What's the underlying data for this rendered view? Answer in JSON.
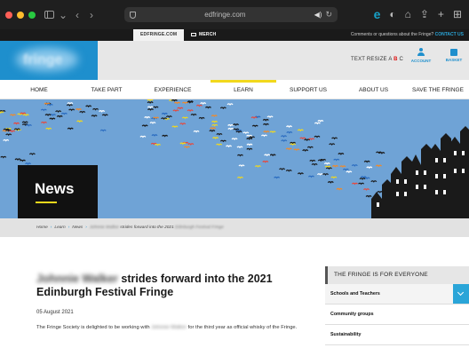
{
  "browser": {
    "url": "edfringe.com",
    "traffic_light_colors": [
      "#ff5f57",
      "#febc2e",
      "#28c840"
    ],
    "icons": [
      "sidebar-icon",
      "chevron-down-icon",
      "back-icon",
      "forward-icon",
      "shield-icon",
      "speaker-icon",
      "reload-icon",
      "extension-icon",
      "privacy-icon",
      "home-icon",
      "share-icon",
      "new-tab-icon",
      "tab-overview-icon"
    ]
  },
  "topbar": {
    "edfringe_label": "EDFRINGE.COM",
    "merch_label": "MERCH",
    "contact_prefix": "Comments or questions about the Fringe?",
    "contact_link": "CONTACT US"
  },
  "header": {
    "logo_alt": "fringe",
    "text_resize_label": "TEXT RESIZE",
    "text_resize_options": [
      "A",
      "B",
      "C"
    ],
    "account_label": "ACCOUNT",
    "basket_label": "BASKET"
  },
  "nav": {
    "items": [
      {
        "label": "HOME"
      },
      {
        "label": "TAKE PART"
      },
      {
        "label": "EXPERIENCE"
      },
      {
        "label": "LEARN",
        "active": true
      },
      {
        "label": "SUPPORT US"
      },
      {
        "label": "ABOUT US"
      },
      {
        "label": "SAVE THE FRINGE"
      }
    ],
    "active_color": "#f2d81c"
  },
  "hero": {
    "title": "News",
    "background_color": "#6fa3d6"
  },
  "breadcrumb": {
    "items": [
      "Home",
      "Learn",
      "News"
    ],
    "current_blurred": "Johnnie Walker",
    "current_rest": "strides forward into the 2021",
    "current_blurred_tail": "Edinburgh Festival Fringe"
  },
  "article": {
    "headline_blurred": "Johnnie Walker",
    "headline_rest": "strides forward into the 2021 Edinburgh Festival Fringe",
    "date": "05 August 2021",
    "body_before": "The Fringe Society is delighted to be working with",
    "body_blurred": "Johnnie Walker",
    "body_after": "for the third year as official whisky of the Fringe."
  },
  "sidebar_panel": {
    "title": "THE FRINGE IS FOR EVERYONE",
    "items": [
      {
        "label": "Schools and Teachers"
      },
      {
        "label": "Community groups"
      },
      {
        "label": "Sustainability"
      }
    ],
    "accent_color": "#2aa5d8"
  }
}
